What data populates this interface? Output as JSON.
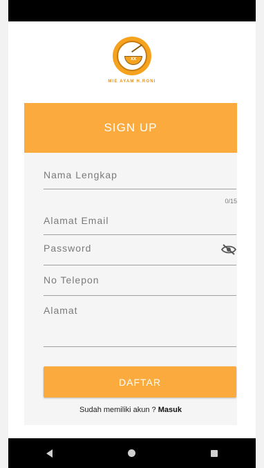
{
  "logo": {
    "badge_text": "XX",
    "caption": "MIE AYAM H.RONI"
  },
  "form": {
    "header": "SIGN UP",
    "fields": {
      "name_label": "Nama Lengkap",
      "name_counter": "0/15",
      "email_label": "Alamat Email",
      "password_label": "Password",
      "phone_label": "No Telepon",
      "address_label": "Alamat"
    },
    "submit_label": "DAFTAR",
    "login_prompt": "Sudah memiliki akun ?",
    "login_link": "Masuk"
  },
  "icons": {
    "password_toggle": "eye-off-icon",
    "nav_back": "back-triangle-icon",
    "nav_home": "home-circle-icon",
    "nav_recent": "recent-apps-square-icon"
  },
  "colors": {
    "accent": "#fbab3d",
    "logo": "#f5a21f",
    "card_bg": "#f5f5f5"
  }
}
